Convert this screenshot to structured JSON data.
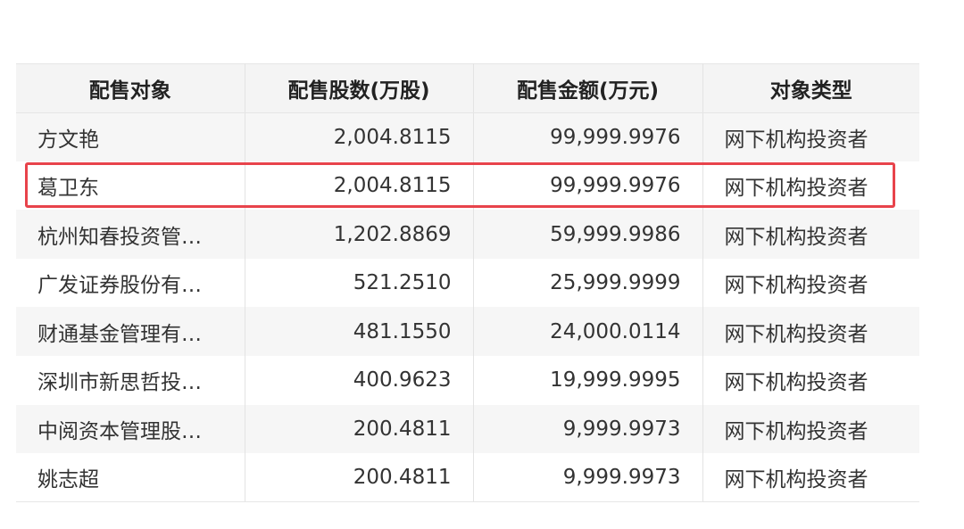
{
  "table": {
    "headers": [
      "配售对象",
      "配售股数(万股)",
      "配售金额(万元)",
      "对象类型"
    ],
    "rows": [
      {
        "name": "方文艳",
        "shares": "2,004.8115",
        "amount": "99,999.9976",
        "type": "网下机构投资者"
      },
      {
        "name": "葛卫东",
        "shares": "2,004.8115",
        "amount": "99,999.9976",
        "type": "网下机构投资者"
      },
      {
        "name": "杭州知春投资管…",
        "shares": "1,202.8869",
        "amount": "59,999.9986",
        "type": "网下机构投资者"
      },
      {
        "name": "广发证券股份有…",
        "shares": "521.2510",
        "amount": "25,999.9999",
        "type": "网下机构投资者"
      },
      {
        "name": "财通基金管理有…",
        "shares": "481.1550",
        "amount": "24,000.0114",
        "type": "网下机构投资者"
      },
      {
        "name": "深圳市新思哲投…",
        "shares": "400.9623",
        "amount": "19,999.9995",
        "type": "网下机构投资者"
      },
      {
        "name": "中阅资本管理股…",
        "shares": "200.4811",
        "amount": "9,999.9973",
        "type": "网下机构投资者"
      },
      {
        "name": "姚志超",
        "shares": "200.4811",
        "amount": "9,999.9973",
        "type": "网下机构投资者"
      }
    ]
  },
  "highlight": {
    "color": "#e8434b",
    "row_index": 1
  }
}
